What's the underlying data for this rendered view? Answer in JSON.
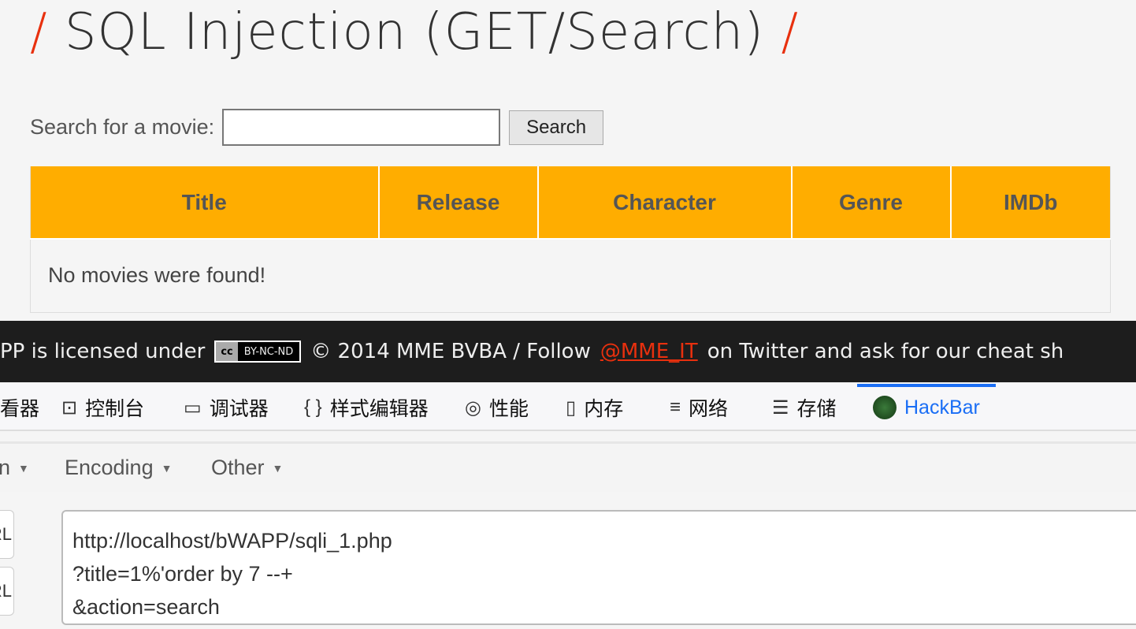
{
  "page": {
    "title": "SQL Injection (GET/Search)",
    "slash": "/"
  },
  "search": {
    "label": "Search for a movie:",
    "value": "",
    "button": "Search"
  },
  "table": {
    "headers": [
      "Title",
      "Release",
      "Character",
      "Genre",
      "IMDb"
    ],
    "empty": "No movies were found!"
  },
  "footer": {
    "text1": "PP is licensed under",
    "cc_icon": "cc",
    "cc_label": "BY-NC-ND",
    "text2": "© 2014 MME BVBA / Follow",
    "link": "@MME_IT",
    "text3": "on Twitter and ask for our cheat sh"
  },
  "devtools": {
    "tabs": [
      {
        "icon": "inspector-icon",
        "label": "看器"
      },
      {
        "icon": "console-icon",
        "label": "控制台"
      },
      {
        "icon": "debugger-icon",
        "label": "调试器"
      },
      {
        "icon": "style-editor-icon",
        "label": "样式编辑器"
      },
      {
        "icon": "performance-icon",
        "label": "性能"
      },
      {
        "icon": "memory-icon",
        "label": "内存"
      },
      {
        "icon": "network-icon",
        "label": "网络"
      },
      {
        "icon": "storage-icon",
        "label": "存储"
      },
      {
        "icon": "hackbar-icon",
        "label": "HackBar"
      }
    ],
    "active": "HackBar",
    "accent": "#1a6ef5"
  },
  "hackbar": {
    "menus": [
      "n",
      "Encoding",
      "Other"
    ],
    "buttons": [
      "URL",
      "RL"
    ],
    "url": "http://localhost/bWAPP/sqli_1.php\n?title=1%'order by 7 --+\n&action=search"
  }
}
